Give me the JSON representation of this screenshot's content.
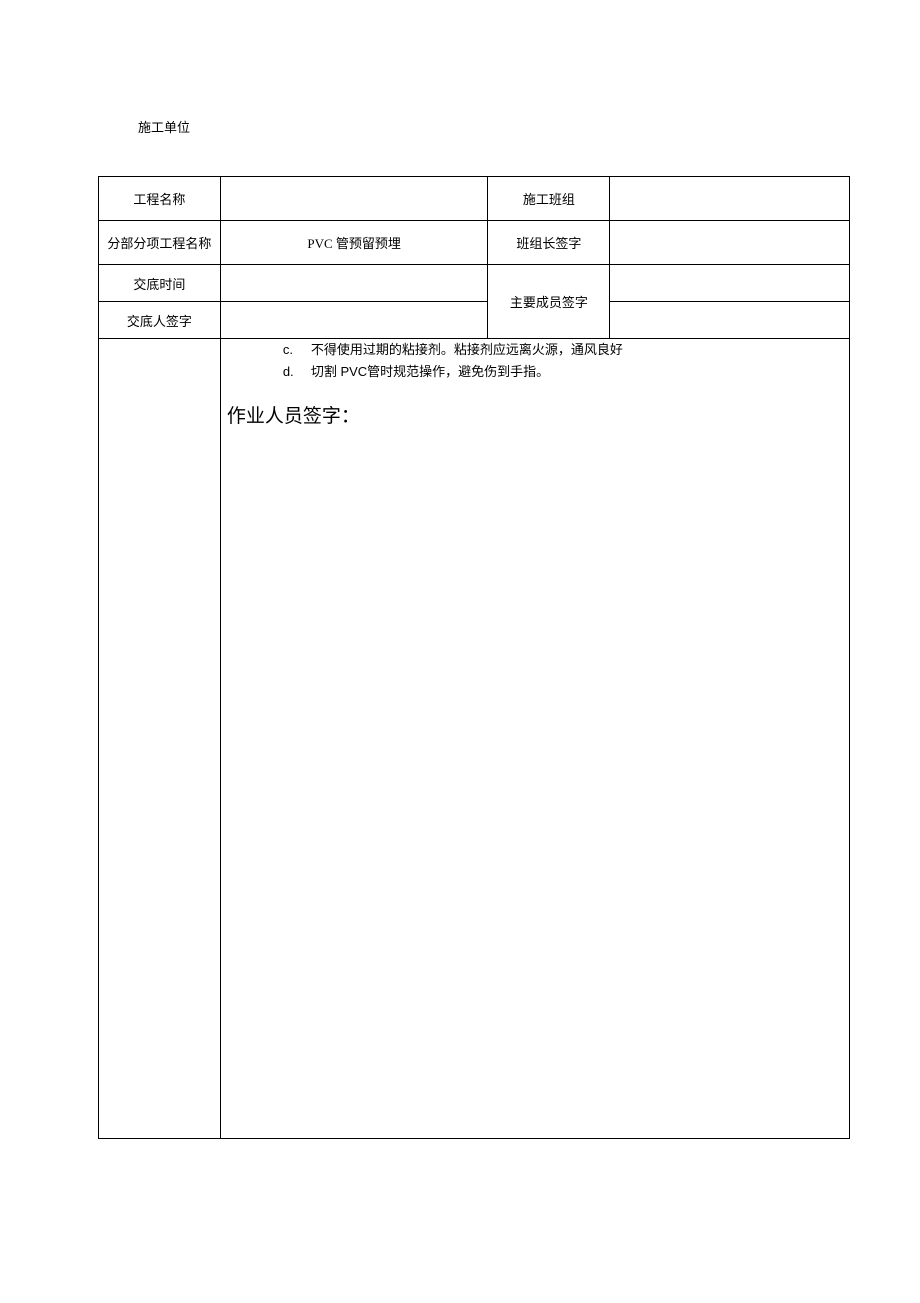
{
  "header": {
    "construction_unit_label": "施工单位"
  },
  "table": {
    "row1": {
      "label_project_name": "工程名称",
      "value_project_name": "",
      "label_team": "施工班组",
      "value_team": ""
    },
    "row2": {
      "label_sub_project": "分部分项工程名称",
      "value_sub_project": "PVC 管预留预埋",
      "label_leader_sign": "班组长签字",
      "value_leader_sign": ""
    },
    "row3": {
      "label_disclosure_time": "交底时间",
      "value_disclosure_time": "",
      "label_members_sign": "主要成员签字",
      "value_members_sign_top": ""
    },
    "row4": {
      "label_discloser_sign": "交底人签字",
      "value_discloser_sign": "",
      "value_members_sign_bottom": ""
    }
  },
  "content": {
    "item_c_marker": "c.",
    "item_c_text": "不得使用过期的粘接剂。粘接剂应远离火源，通风良好",
    "item_d_marker": "d.",
    "item_d_text": "切割 PVC管时规范操作，避免伤到手指。",
    "signature_label": "作业人员签字："
  }
}
